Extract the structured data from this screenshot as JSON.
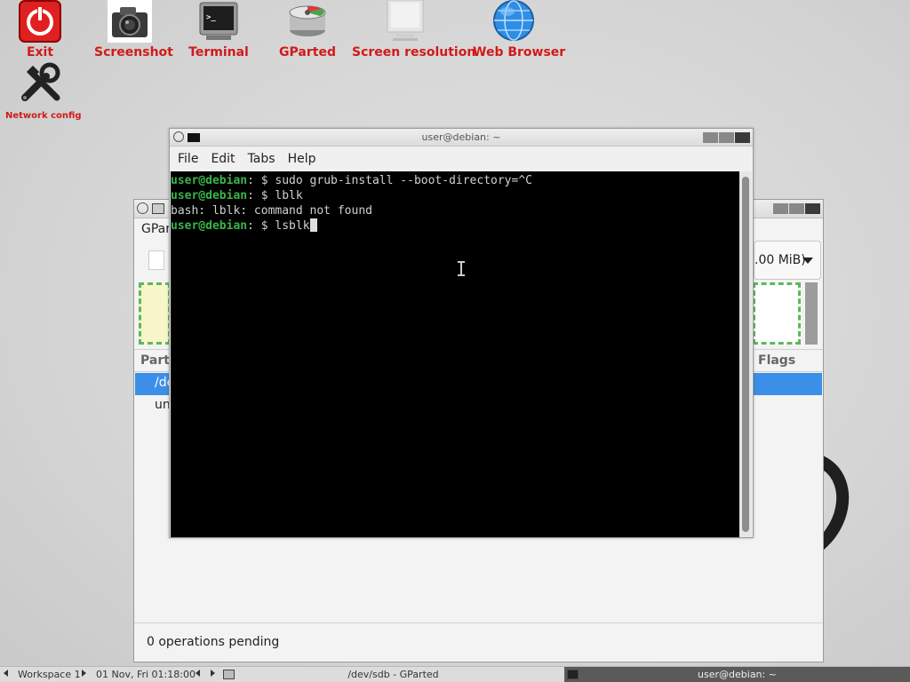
{
  "desktop": {
    "icons": [
      {
        "label": "Exit"
      },
      {
        "label": "Screenshot"
      },
      {
        "label": "Terminal"
      },
      {
        "label": "GParted"
      },
      {
        "label": "Screen resolution"
      },
      {
        "label": "Web Browser"
      },
      {
        "label": "Network config"
      }
    ],
    "label_color": "#d11a1a"
  },
  "terminal": {
    "title": "user@debian: ~",
    "menu": [
      "File",
      "Edit",
      "Tabs",
      "Help"
    ],
    "lines": [
      {
        "prompt": "user@debian",
        "sep": ": $ ",
        "text": "sudo grub-install --boot-directory=^C"
      },
      {
        "prompt": "user@debian",
        "sep": ": $ ",
        "text": "lblk"
      },
      {
        "prompt": "",
        "sep": "",
        "text": "bash: lblk: command not found"
      },
      {
        "prompt": "user@debian",
        "sep": ": $ ",
        "text": "lsblk"
      }
    ],
    "prompt_color": "#39b54a",
    "background": "#000000"
  },
  "gparted": {
    "menu_partial": "GPar",
    "device_partial": ".00 MiB)",
    "columns": {
      "partition_partial": "Parti",
      "flags": "Flags"
    },
    "rows": [
      {
        "partial": "/de",
        "selected": true
      },
      {
        "partial": "un",
        "selected": false
      }
    ],
    "status": "0 operations pending",
    "selection_color": "#3b8fe8"
  },
  "taskbar": {
    "workspace": "Workspace 1",
    "clock": "01 Nov, Fri 01:18:00",
    "tasks": [
      {
        "label": "/dev/sdb - GParted",
        "active": false
      },
      {
        "label": "user@debian: ~",
        "active": true
      }
    ]
  }
}
